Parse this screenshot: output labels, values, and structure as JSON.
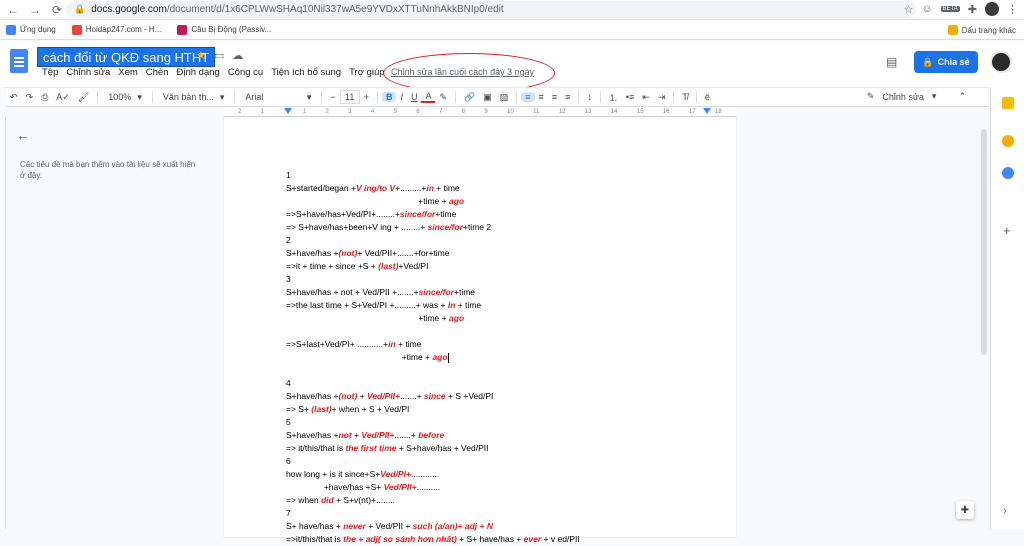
{
  "browser": {
    "url_host": "docs.google.com",
    "url_path": "/document/d/1x6CPLWwSHAq10Nil337wA5e9YVDxXTTuNnhAkkBNIp0/edit",
    "beta_badge": "BETA"
  },
  "bookmarks": {
    "items": [
      {
        "label": "Ứng dụng",
        "color": "#4285f4"
      },
      {
        "label": "Hoidap247.com - H...",
        "color": "#e8453c"
      },
      {
        "label": "Câu Bị Động (Passiv...",
        "color": "#c2185b"
      }
    ],
    "right_label": "Dấu trang khác"
  },
  "docs": {
    "title": "cách đổi từ QKĐ sang HTHT",
    "menu": [
      "Tệp",
      "Chỉnh sửa",
      "Xem",
      "Chèn",
      "Định dạng",
      "Công cụ",
      "Tiện ích bổ sung",
      "Trợ giúp"
    ],
    "last_edit": "Chỉnh sửa lần cuối cách đây 3 ngày",
    "share_label": "Chia sẻ"
  },
  "toolbar": {
    "zoom": "100%",
    "style": "Văn bản th...",
    "font": "Arial",
    "font_size": "11",
    "edit_mode": "Chỉnh sửa"
  },
  "ruler": {
    "ticks": [
      "2",
      "1",
      "",
      "1",
      "2",
      "3",
      "4",
      "5",
      "6",
      "7",
      "8",
      "9",
      "10",
      "11",
      "12",
      "13",
      "14",
      "15",
      "16",
      "17",
      "18"
    ]
  },
  "outline": {
    "hint": "Các tiêu đề mà bạn thêm vào tài liệu sẽ xuất hiện ở đây."
  },
  "document": {
    "lines": [
      [
        {
          "t": "1"
        }
      ],
      [
        {
          "t": "S+started/began +"
        },
        {
          "t": "V ing/to V",
          "r": true
        },
        {
          "t": "+.........+"
        },
        {
          "t": "in",
          "r": true
        },
        {
          "t": " + time"
        }
      ],
      [
        {
          "t": "                                                        +time + "
        },
        {
          "t": "ago",
          "r": true
        }
      ],
      [
        {
          "t": "=>S+have/has+Ved/PI+........+"
        },
        {
          "t": "since/for",
          "r": true
        },
        {
          "t": "+time"
        }
      ],
      [
        {
          "t": "=> S+have/has+been+V ing + ........+ "
        },
        {
          "t": "since/for",
          "r": true
        },
        {
          "t": "+time 2"
        }
      ],
      [
        {
          "t": "2"
        }
      ],
      [
        {
          "t": "S+have/has +"
        },
        {
          "t": "(not)",
          "r": true
        },
        {
          "t": "+ Ved/PII+.......+for+time"
        }
      ],
      [
        {
          "t": "=>it + time + since +S + "
        },
        {
          "t": "(last)",
          "r": true
        },
        {
          "t": "+Ved/PI"
        }
      ],
      [
        {
          "t": "3"
        }
      ],
      [
        {
          "t": "S+have/has + not + Ved/PII +.......+"
        },
        {
          "t": "since/for",
          "r": true
        },
        {
          "t": "+time"
        }
      ],
      [
        {
          "t": "=>the last time + S+Ved/PI +.........+ was + "
        },
        {
          "t": "In",
          "r": true
        },
        {
          "t": " + time"
        }
      ],
      [
        {
          "t": "                                                        +time + "
        },
        {
          "t": "ago",
          "r": true
        }
      ],
      [
        {
          "t": ""
        }
      ],
      [
        {
          "t": "=>S+last+Ved/PI+ ...........+"
        },
        {
          "t": "in",
          "r": true
        },
        {
          "t": " + time"
        }
      ],
      [
        {
          "t": "                                                 +time + "
        },
        {
          "t": "ago",
          "r": true
        },
        {
          "t": "",
          "cursor": true
        }
      ],
      [
        {
          "t": ""
        }
      ],
      [
        {
          "t": "4"
        }
      ],
      [
        {
          "t": "S+have/has +"
        },
        {
          "t": "(not)",
          "r": true
        },
        {
          "t": " + "
        },
        {
          "t": "Ved/PII+",
          "r": true
        },
        {
          "t": ".......+ "
        },
        {
          "t": "since",
          "r": true
        },
        {
          "t": " + S +Ved/PI"
        }
      ],
      [
        {
          "t": "=> S+ "
        },
        {
          "t": "(last)",
          "r": true
        },
        {
          "t": "+ when + S + Ved/PI"
        }
      ],
      [
        {
          "t": "5"
        }
      ],
      [
        {
          "t": "S+have/has +"
        },
        {
          "t": "not",
          "r": true
        },
        {
          "t": " + "
        },
        {
          "t": "Ved/PII+",
          "r": true
        },
        {
          "t": ".......+ "
        },
        {
          "t": "before",
          "r": true
        }
      ],
      [
        {
          "t": "=> it/this/that is "
        },
        {
          "t": "the first time",
          "r": true
        },
        {
          "t": " + S+have/has + Ved/PII"
        }
      ],
      [
        {
          "t": "6"
        }
      ],
      [
        {
          "t": "how long + is it since+S+"
        },
        {
          "t": "Ved/PI+",
          "r": true
        },
        {
          "t": "............"
        }
      ],
      [
        {
          "t": "                +have/has +S+ "
        },
        {
          "t": "Ved/PII+",
          "r": true
        },
        {
          "t": ".........."
        }
      ],
      [
        {
          "t": "=> when "
        },
        {
          "t": "did",
          "r": true
        },
        {
          "t": " + S+v(nt)+........"
        }
      ],
      [
        {
          "t": "7"
        }
      ],
      [
        {
          "t": "S+ have/has + "
        },
        {
          "t": "never",
          "r": true
        },
        {
          "t": " + Ved/PII + "
        },
        {
          "t": "such (a/an)+ adj + N",
          "r": true
        }
      ],
      [
        {
          "t": "=>it/this/that is "
        },
        {
          "t": "the + adj( so sánh hơn nhất)",
          "r": true
        },
        {
          "t": " + S+ have/has + "
        },
        {
          "t": "ever",
          "r": true
        },
        {
          "t": " + v ed/PII"
        }
      ]
    ]
  },
  "colors": {
    "accent": "#1a73e8",
    "annotation": "#e0201e",
    "doc_red": "#e0201e"
  }
}
